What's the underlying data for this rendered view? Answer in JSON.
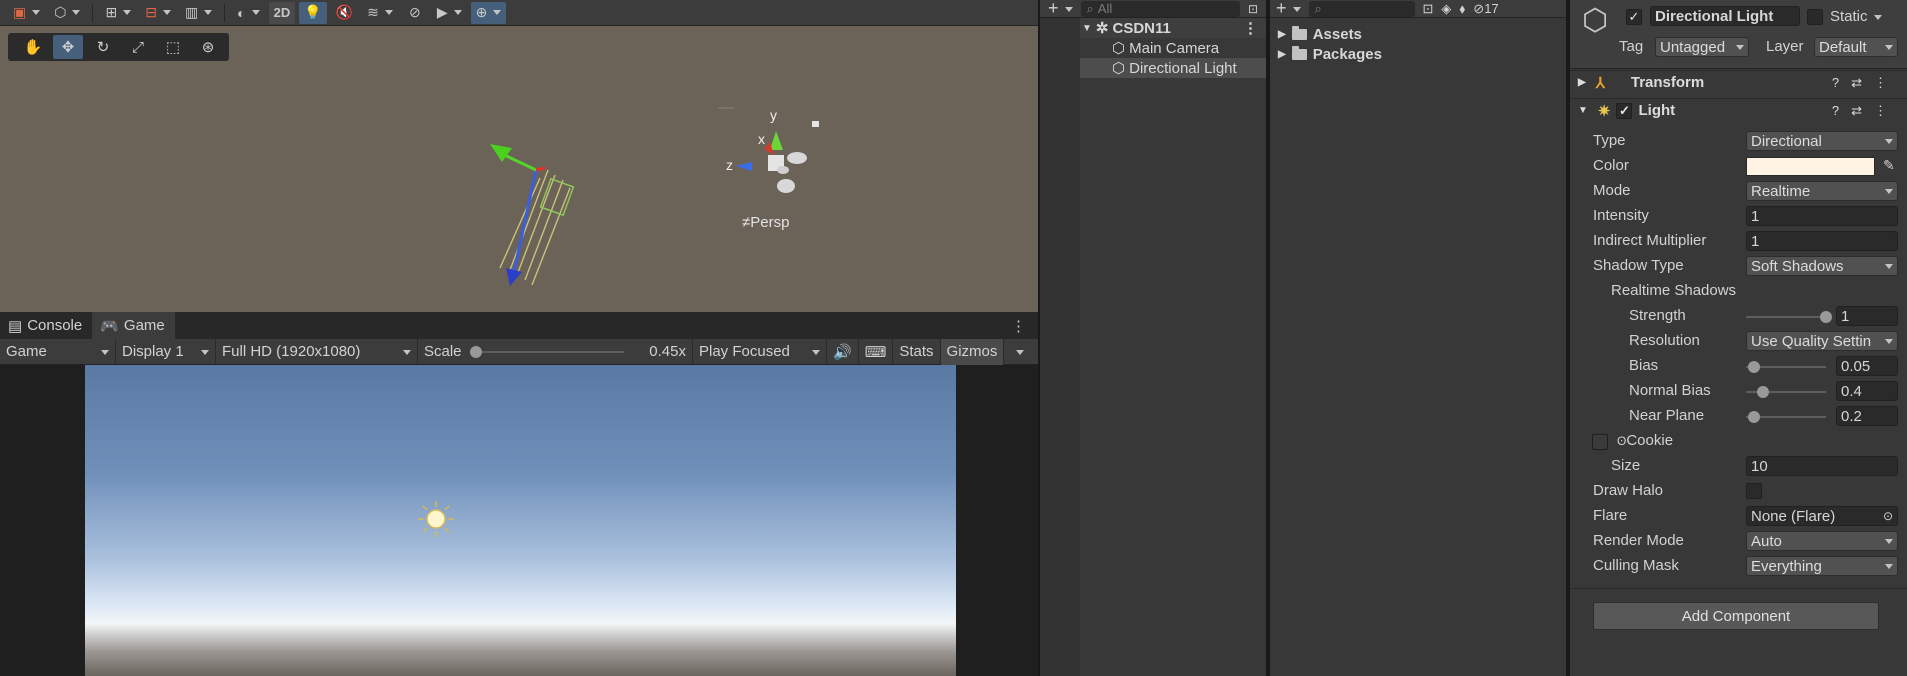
{
  "scene": {
    "toolbar": {
      "mode_2d": "2D"
    },
    "gizmo": {
      "axis_y": "y",
      "axis_x": "x",
      "axis_z": "z",
      "projection": "≠Persp"
    }
  },
  "game": {
    "tabs": [
      {
        "label": "Console"
      },
      {
        "label": "Game"
      }
    ],
    "bar": {
      "view": "Game",
      "display": "Display 1",
      "resolution": "Full HD (1920x1080)",
      "scale_label": "Scale",
      "scale_value": "0.45x",
      "scale_fraction": 0.0,
      "play_mode": "Play Focused",
      "stats": "Stats",
      "gizmos": "Gizmos"
    }
  },
  "hierarchy": {
    "search_placeholder": "All",
    "scene_name": "CSDN11",
    "items": [
      {
        "label": "Main Camera"
      },
      {
        "label": "Directional Light"
      }
    ]
  },
  "project": {
    "hidden_count": "17",
    "folders": [
      {
        "label": "Assets"
      },
      {
        "label": "Packages"
      }
    ]
  },
  "inspector": {
    "object_name": "Directional Light",
    "static_label": "Static",
    "tag_label": "Tag",
    "tag_value": "Untagged",
    "layer_label": "Layer",
    "layer_value": "Default",
    "components": {
      "transform": "Transform",
      "light": "Light"
    },
    "light": {
      "type_label": "Type",
      "type_value": "Directional",
      "color_label": "Color",
      "color_value": "#fff4e4",
      "mode_label": "Mode",
      "mode_value": "Realtime",
      "intensity_label": "Intensity",
      "intensity_value": "1",
      "indirect_label": "Indirect Multiplier",
      "indirect_value": "1",
      "shadow_type_label": "Shadow Type",
      "shadow_type_value": "Soft Shadows",
      "realtime_shadows_label": "Realtime Shadows",
      "strength_label": "Strength",
      "strength_value": "1",
      "resolution_label": "Resolution",
      "resolution_value": "Use Quality Settin",
      "bias_label": "Bias",
      "bias_value": "0.05",
      "normal_bias_label": "Normal Bias",
      "normal_bias_value": "0.4",
      "near_plane_label": "Near Plane",
      "near_plane_value": "0.2",
      "cookie_label": "Cookie",
      "size_label": "Size",
      "size_value": "10",
      "draw_halo_label": "Draw Halo",
      "flare_label": "Flare",
      "flare_value": "None (Flare)",
      "render_mode_label": "Render Mode",
      "render_mode_value": "Auto",
      "culling_label": "Culling Mask",
      "culling_value": "Everything"
    },
    "add_component": "Add Component"
  }
}
